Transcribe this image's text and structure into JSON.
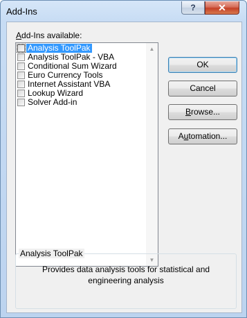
{
  "window": {
    "title": "Add-Ins",
    "help_glyph": "?",
    "close_glyph": "✕"
  },
  "addins": {
    "label_access": "A",
    "label_rest": "dd-Ins available:",
    "items": [
      {
        "label": "Analysis ToolPak",
        "checked": false,
        "selected": true
      },
      {
        "label": "Analysis ToolPak - VBA",
        "checked": false,
        "selected": false
      },
      {
        "label": "Conditional Sum Wizard",
        "checked": false,
        "selected": false
      },
      {
        "label": "Euro Currency Tools",
        "checked": false,
        "selected": false
      },
      {
        "label": "Internet Assistant VBA",
        "checked": false,
        "selected": false
      },
      {
        "label": "Lookup Wizard",
        "checked": false,
        "selected": false
      },
      {
        "label": "Solver Add-in",
        "checked": false,
        "selected": false
      }
    ],
    "scroll_up_glyph": "▲",
    "scroll_down_glyph": "▼"
  },
  "buttons": {
    "ok": "OK",
    "cancel": "Cancel",
    "browse_access": "B",
    "browse_rest": "rowse...",
    "automation_pre": "A",
    "automation_access": "u",
    "automation_rest": "tomation..."
  },
  "description": {
    "title": "Analysis ToolPak",
    "text": "Provides data analysis tools for statistical and engineering analysis"
  },
  "colors": {
    "selection": "#3399ff",
    "close_button": "#c44127"
  }
}
